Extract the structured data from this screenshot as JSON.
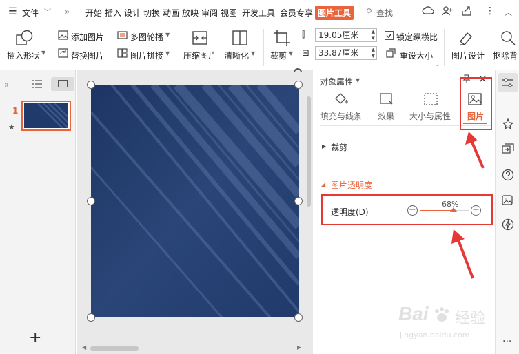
{
  "menu": {
    "file_label": "文件",
    "tabs": [
      "开始",
      "插入",
      "设计",
      "切换",
      "动画",
      "放映",
      "审阅",
      "视图",
      "开发工具",
      "会员专享"
    ],
    "active_tab": "图片工具",
    "search_label": "查找"
  },
  "ribbon": {
    "insert_shape": "插入形状",
    "add_image": "添加图片",
    "replace_image": "替换图片",
    "multi_carousel": "多图轮播",
    "image_splice": "图片拼接",
    "compress_image": "压缩图片",
    "sharpen": "清晰化",
    "crop": "裁剪",
    "height_value": "19.05厘米",
    "width_value": "33.87厘米",
    "lock_ratio": "锁定纵横比",
    "reset_size": "重设大小",
    "image_design": "图片设计",
    "remove_bg": "抠除背"
  },
  "thumbnails": {
    "slide_number": "1"
  },
  "panel": {
    "title": "对象属性",
    "tabs": [
      "填充与线条",
      "效果",
      "大小与属性",
      "图片"
    ],
    "active_tab_index": 3,
    "sections": {
      "crop": "裁剪",
      "transparency": "图片透明度"
    },
    "transparency_label": "透明度(D)",
    "transparency_value": "68%",
    "transparency_fraction": 0.68
  },
  "watermark": {
    "brand": "Bai",
    "brand2": "经验",
    "url": "jingyan.baidu.com"
  },
  "colors": {
    "accent": "#e8643c",
    "image_blue": "#1f3a6b",
    "highlight_red": "#e53935"
  }
}
